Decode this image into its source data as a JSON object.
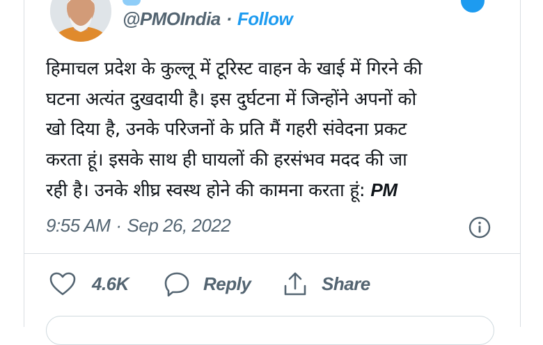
{
  "author": {
    "handle": "@PMOIndia",
    "separator": "·",
    "follow_label": "Follow"
  },
  "tweet": {
    "lines": [
      "हिमाचल प्रदेश के कुल्लू में टूरिस्ट वाहन के खाई में गिरने की",
      "घटना अत्यंत दुखदायी है। इस दुर्घटना में जिन्होंने अपनों को",
      "खो दिया है, उनके परिजनों के प्रति मैं गहरी संवेदना प्रकट",
      "करता हूं। इसके साथ ही घायलों की हरसंभव मदद की जा",
      "रही है। उनके शीघ्र स्वस्थ होने की कामना करता हूं:"
    ],
    "signature": "PM"
  },
  "meta": {
    "time": "9:55 AM",
    "separator": "·",
    "date": "Sep 26, 2022"
  },
  "actions": {
    "likes_count": "4.6K",
    "reply_label": "Reply",
    "share_label": "Share"
  },
  "icons": {
    "like": "heart-icon",
    "reply": "speech-bubble-icon",
    "share": "share-arrow-icon",
    "info": "info-icon"
  },
  "colors": {
    "accent": "#1d9bf0",
    "muted": "#536471",
    "text": "#0f1419",
    "border": "#d8dde2"
  }
}
